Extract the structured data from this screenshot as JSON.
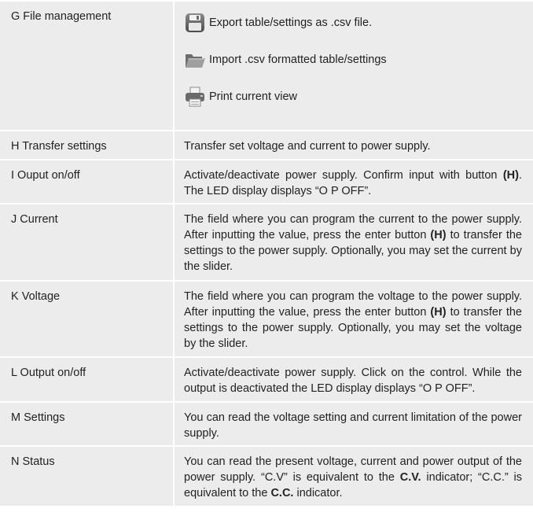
{
  "rows": [
    {
      "label": "G File management",
      "items": [
        {
          "icon": "save-disk-icon",
          "text": "Export table/settings as .csv file."
        },
        {
          "icon": "open-folder-icon",
          "text": "Import .csv formatted table/settings"
        },
        {
          "icon": "printer-icon",
          "text": "Print current view"
        }
      ]
    },
    {
      "label": "H Transfer settings",
      "desc": [
        "Transfer set voltage and current to power supply."
      ]
    },
    {
      "label": "I Ouput on/off",
      "desc": [
        "Activate/deactivate power supply. Confirm input with button ",
        "(H)",
        ". The LED display displays “O P OFF”."
      ]
    },
    {
      "label": "J Current",
      "desc": [
        "The field where you can program the current to the power supply. After inputting the value, press the enter button ",
        "(H)",
        " to transfer the settings to the power supply. Optionally, you may set the current by the slider."
      ]
    },
    {
      "label": "K Voltage",
      "desc": [
        "The field where you can program the voltage to the power supply. After inputting the value, press the enter button ",
        "(H)",
        " to transfer the settings to the power supply. Optionally, you may set the voltage by the slider."
      ]
    },
    {
      "label": "L Output on/off",
      "desc": [
        "Activate/deactivate power supply. Click on the control. While the output is deactivated the LED display displays “O P OFF”."
      ]
    },
    {
      "label": "M Settings",
      "desc": [
        "You can read the voltage setting and current limitation of the power supply."
      ]
    },
    {
      "label": "N Status",
      "desc": [
        "You can read the present voltage, current and power output of the power supply. “C.V” is equivalent to the ",
        "C.V.",
        " indicator; “C.C.” is equivalent to the ",
        "C.C.",
        " indicator."
      ]
    }
  ]
}
